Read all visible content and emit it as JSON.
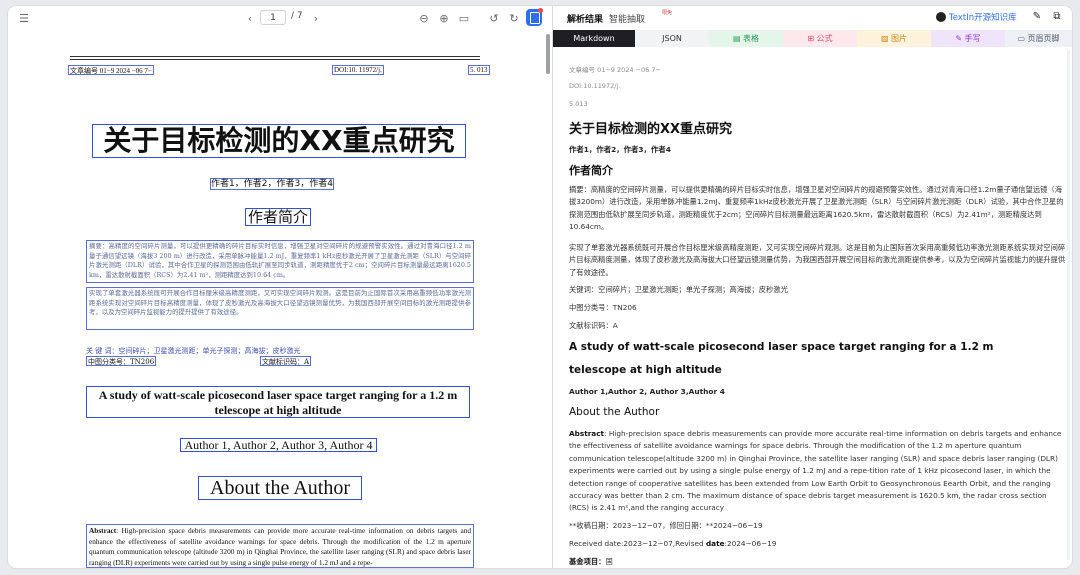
{
  "viewer": {
    "page_current": "1",
    "page_total": "/ 7"
  },
  "doc": {
    "meta_number": "文章编号   01−9     2024    −06 7−",
    "meta_doi": "DOI:10. 11972/j.",
    "meta_code": "5. 013",
    "cn_title": "关于目标检测的XX重点研究",
    "cn_authors": "作者1，作者2，作者3，作者4",
    "cn_heading": "作者简介",
    "cn_abstract": "摘要：高精度的空间碎片测量，可以提供更精确的碎片目标实时信息，增强卫星对空间碎片的规避预警实效性。通过对青海口径1.2 m量子通信望远镜（海拔3 200 m）进行改造，采用单脉冲能量1.2 mJ，重复频率1 kHz皮秒激光开展了卫星激光测距（SLR）与空间碎片激光测距（DLR）试验，其中合作卫星的探测范围由低轨扩展至同步轨道，测距精度优于2 cm；空间碎片目标测量最远距离1620.5 km，雷达散射截面积（RCS）为2.41 m²，测距精度达到10.64 cm。",
    "cn_para2": "实现了单套激光器系统既可开展合作目标厘米级高精度测距，又可实现空间碎片观测。这是目前为止国际首次采用高重频低功率激光测距系统实现对空间碎片目标高精度测量，体现了皮秒激光及高海拔大口径望远镜测量优势，为我国西部开展空间目标的激光测距提供参考，以及为空间碎片监视能力的提升提供了有效途径。",
    "cn_keywords": "关   键   词：空间碎片；卫星激光测距；单光子探测；高海拔；皮秒激光",
    "cn_class": "中图分类号：TN206",
    "cn_docid": "文献标识码：A",
    "en_title": "A study of watt-scale picosecond laser space target ranging for a 1.2 m telescope at high altitude",
    "en_authors": "Author 1, Author 2, Author 3, Author 4",
    "en_heading": "About the Author",
    "en_abstract_label": "Abstract",
    "en_abstract": ": High-precision space debris measurements can provide more accurate real-time information on debris targets and enhance the effectiveness of satellite avoidance warnings for space debris.  Through the modification of the 1.2 m aperture quantum communication telescope (altitude 3200 m) in Qinghai Province, the satellite laser ranging (SLR) and space debris laser ranging (DLR) experiments were carried out by using a single pulse energy of 1.2 mJ and a repe-"
  },
  "right": {
    "tabs": [
      "解析结果",
      "智能抽取"
    ],
    "badge": "限免",
    "github": "TextIn开源知识库",
    "formats": [
      {
        "label": "Markdown",
        "bg": "#1f1f23",
        "color": "#ffffff"
      },
      {
        "label": "JSON",
        "bg": "#f2f3f5",
        "color": "#333333"
      },
      {
        "label": "▤ 表格",
        "bg": "#e4f6ea",
        "color": "#2a9a56"
      },
      {
        "label": "⊞ 公式",
        "bg": "#fde8ec",
        "color": "#d4506a"
      },
      {
        "label": "▨ 图片",
        "bg": "#fdf2dc",
        "color": "#c88a1c"
      },
      {
        "label": "✎ 手写",
        "bg": "#f0e4fb",
        "color": "#8a3fd1"
      },
      {
        "label": "▭ 页眉页脚",
        "bg": "#edf0f5",
        "color": "#556070"
      }
    ],
    "meta1": "文章编号 01−9 2024 −06 7−",
    "meta2": "DOI:10.11972/j.",
    "meta3": "5.013",
    "h_title": "关于目标检测的XX重点研究",
    "authors": "作者1，作者2，作者3，作者4",
    "h_author": "作者简介",
    "abstract_cn": "摘要：高精度的空间碎片测量，可以提供更精确的碎片目标实时信息，增强卫星对空间碎片的规避预警实效性。通过对青海口径1.2m量子通信望远镜（海拔3200m）进行改造，采用单脉冲能量1.2mJ、重复频率1kHz皮秒激光开展了卫星激光测距（SLR）与空间碎片激光测距（DLR）试验，其中合作卫星的探测范围由低轨扩展至同步轨道，测距精度优于2cm；空间碎片目标测量最远距离1620.5km，雷达散射截面积（RCS）为2.41m²，测距精度达到10.64cm。",
    "abstract_cn2": "实现了单套激光器系统既可开展合作目标厘米级高精度测距，又可实现空间碎片观测。这是目前为止国际首次采用高重频低功率激光测距系统实现对空间碎片目标高精度测量，体现了皮秒激光及高海拔大口径望远镜测量优势，为我国西部开展空间目标的激光测距提供参考，以及为空间碎片监视能力的提升提供了有效途径。",
    "keywords": "关键词：空间碎片；卫星激光测距；单光子探测；高海拔；皮秒激光",
    "class_no": "中图分类号：TN206",
    "doc_id": "文献标识码：A",
    "en_title1": "A study of watt-scale picosecond laser space target ranging for a 1.2 m",
    "en_title2": "telescope at high altitude",
    "en_authors": "Author 1,Author 2, Author 3,Author 4",
    "en_heading": "About the Author",
    "en_abs_label": "Abstract",
    "en_abs": ": High-precision space debris measurements can provide more accurate real-time information on debris targets and enhance the effectiveness of satellite avoidance warnings for space debris. Through the modification of the 1.2 m aperture quantum communication telescope(altitude 3200 m) in Qinghai Province, the satellite laser ranging (SLR) and space debris laser ranging (DLR) experiments were carried out by using a single pulse energy of 1.2 mJ and a repe-tition rate of 1 kHz picosecond laser, in which the detection range of cooperative satellites has been extended from Low Earth Orbit to Geosynchronous Eearth Orbit, and the ranging accuracy was better than 2 cm. The maximum distance of space debris target measurement is 1620.5 km, the radar cross section (RCS) is 2.41 m²,and the ranging accuracy",
    "received_cn": "**收稿日期：2023−12−07，修回日期：**2024−06−19",
    "received_en_a": "Received date:2023−12−07,Revised ",
    "received_en_b": "date",
    "received_en_c": ":2024−06−19",
    "fund": "基金项目：",
    "fund_val": "国"
  }
}
